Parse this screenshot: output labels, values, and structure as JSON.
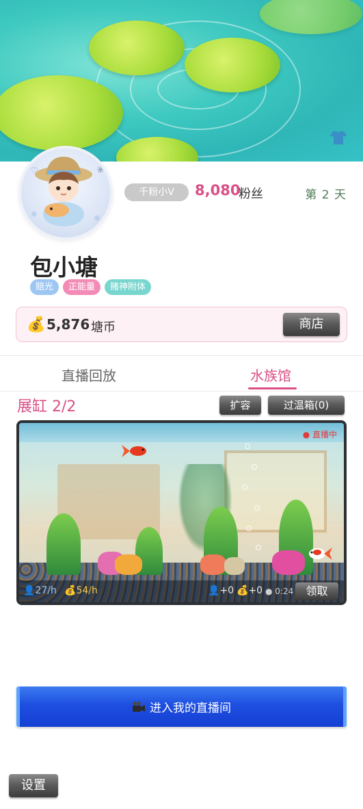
{
  "profile": {
    "fan_badge": "千粉小V",
    "fans_count": "8,080",
    "fans_label": "粉丝",
    "day_label": "第 2 天",
    "username": "包小塘",
    "tags": [
      "赔光",
      "正能量",
      "赌神附体"
    ]
  },
  "coins": {
    "amount": "5,876",
    "label": "塘币",
    "shop_label": "商店"
  },
  "tabs": [
    {
      "label": "直播回放",
      "active": false
    },
    {
      "label": "水族馆",
      "active": true
    }
  ],
  "tank": {
    "title": "展缸 2/2",
    "expand_label": "扩容",
    "incubator_label": "过温箱(0)",
    "live_label": "直播中",
    "stats": {
      "fans_rate": "27/h",
      "coin_rate": "54/h",
      "pending_fans": "+0",
      "pending_coins": "+0",
      "timer": "0:24",
      "claim_label": "领取"
    }
  },
  "live_room_button": "进入我的直播间",
  "settings_label": "设置",
  "colors": {
    "accent_pink": "#d94f86",
    "live_blue": "#1e4fe0",
    "day_green": "#4f7a55"
  }
}
